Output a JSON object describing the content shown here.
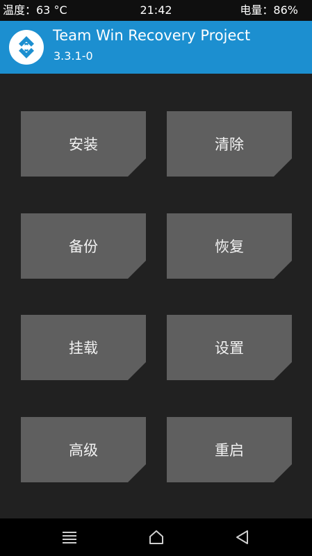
{
  "status_bar": {
    "temperature": "温度：63 °C",
    "time": "21:42",
    "battery": "电量：86%"
  },
  "header": {
    "title": "Team Win Recovery Project",
    "version": "3.3.1-0",
    "logo_icon": "twrp-logo-icon"
  },
  "menu": {
    "tiles": [
      {
        "label": "安装"
      },
      {
        "label": "清除"
      },
      {
        "label": "备份"
      },
      {
        "label": "恢复"
      },
      {
        "label": "挂载"
      },
      {
        "label": "设置"
      },
      {
        "label": "高级"
      },
      {
        "label": "重启"
      }
    ]
  },
  "nav_bar": {
    "icons": [
      "menu-icon",
      "home-icon",
      "back-icon"
    ]
  },
  "colors": {
    "accent": "#1c8fd0",
    "background": "#212121",
    "tile": "#5f5f5f",
    "status_bar": "#0f0f0f",
    "nav_bar": "#000000"
  }
}
